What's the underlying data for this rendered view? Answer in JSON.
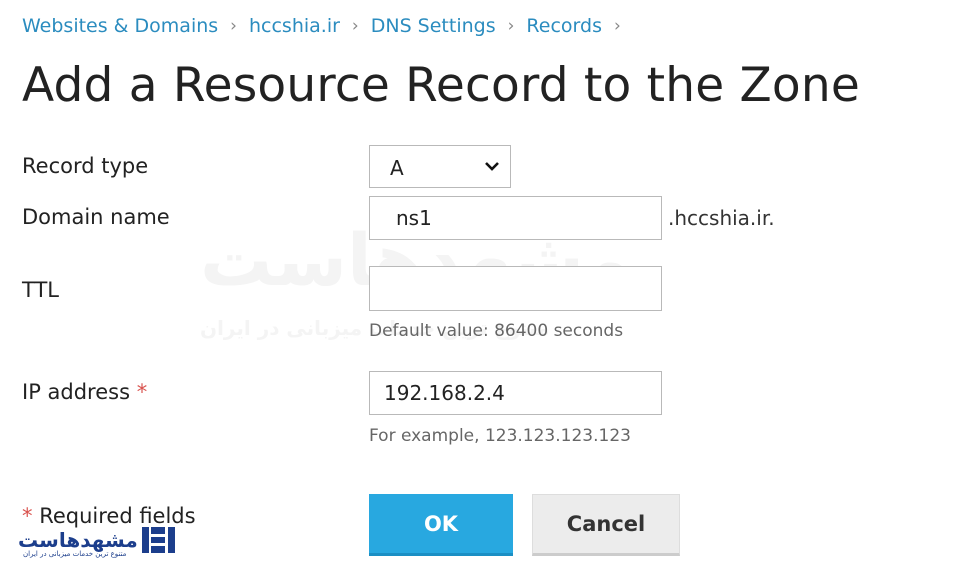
{
  "breadcrumb": [
    "Websites & Domains",
    "hccshia.ir",
    "DNS Settings",
    "Records"
  ],
  "page_title": "Add a Resource Record to the Zone",
  "form": {
    "record_type": {
      "label": "Record type",
      "value": "A"
    },
    "domain_name": {
      "label": "Domain name",
      "value": "ns1",
      "suffix": ".hccshia.ir."
    },
    "ttl": {
      "label": "TTL",
      "value": "",
      "hint": "Default value: 86400 seconds"
    },
    "ip_address": {
      "label": "IP address",
      "required_mark": "*",
      "value": "192.168.2.4",
      "hint": "For example, 123.123.123.123"
    },
    "required_note": {
      "mark": "*",
      "text": "Required fields"
    }
  },
  "buttons": {
    "ok": "OK",
    "cancel": "Cancel"
  },
  "watermark": {
    "text": "مشهدهاست",
    "subtext": "متنوع ترین خدمات میزبانی در ایران"
  },
  "colors": {
    "link": "#2b8cbf",
    "ok_button": "#28a8e0",
    "required": "#d9534f",
    "logo": "#1c3e8c"
  }
}
